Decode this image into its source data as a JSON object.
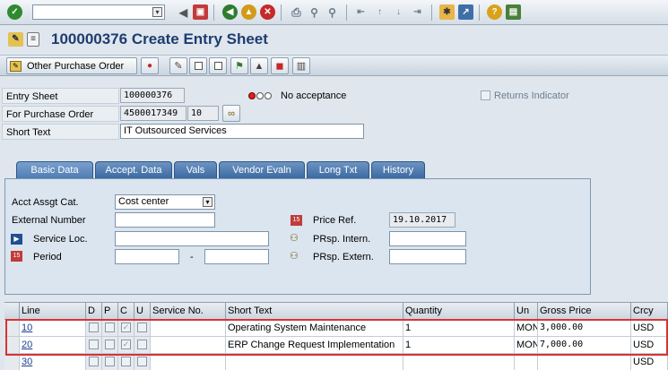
{
  "system_toolbar": {
    "command_field_value": "",
    "icons": [
      "enter-icon",
      "save-icon",
      "back-icon",
      "exit-icon",
      "cancel-icon",
      "print-icon",
      "find-icon",
      "find-next-icon",
      "first-page-icon",
      "previous-page-icon",
      "next-page-icon",
      "last-page-icon",
      "new-session-icon",
      "shortcut-icon",
      "help-icon",
      "customize-layout-icon"
    ]
  },
  "title": {
    "text": "100000376 Create Entry Sheet"
  },
  "app_toolbar": {
    "other_po_label": "Other Purchase Order"
  },
  "header": {
    "entry_sheet_label": "Entry Sheet",
    "entry_sheet_value": "100000376",
    "acceptance_text": "No acceptance",
    "returns_indicator_label": "Returns Indicator",
    "returns_indicator_checked": false,
    "po_label": "For Purchase Order",
    "po_value": "4500017349",
    "po_item": "10",
    "short_text_label": "Short Text",
    "short_text_value": "IT Outsourced Services"
  },
  "tabs": [
    {
      "label": "Basic Data",
      "active": true
    },
    {
      "label": "Accept. Data",
      "active": false
    },
    {
      "label": "Vals",
      "active": false
    },
    {
      "label": "Vendor Evaln",
      "active": false
    },
    {
      "label": "Long Txt",
      "active": false
    },
    {
      "label": "History",
      "active": false
    }
  ],
  "basic_data": {
    "acct_assgt_label": "Acct Assgt Cat.",
    "acct_assgt_value": "Cost center",
    "external_number_label": "External Number",
    "external_number_value": "",
    "service_loc_label": "Service Loc.",
    "service_loc_value": "",
    "period_label": "Period",
    "period_from": "",
    "period_sep": "-",
    "period_to": "",
    "price_ref_label": "Price Ref.",
    "price_ref_value": "19.10.2017",
    "prsp_intern_label": "PRsp. Intern.",
    "prsp_intern_value": "",
    "prsp_extern_label": "PRsp. Extern.",
    "prsp_extern_value": ""
  },
  "table": {
    "columns": [
      "Line",
      "D",
      "P",
      "C",
      "U",
      "Service No.",
      "Short Text",
      "Quantity",
      "Un",
      "Gross Price",
      "Crcy"
    ],
    "rows": [
      {
        "line": "10",
        "service_no": "",
        "short_text": "Operating System Maintenance",
        "quantity": "1",
        "unit": "MON",
        "gross_price": "3,000.00",
        "currency": "USD",
        "c_checked": true
      },
      {
        "line": "20",
        "service_no": "",
        "short_text": "ERP Change Request Implementation",
        "quantity": "1",
        "unit": "MON",
        "gross_price": "7,000.00",
        "currency": "USD",
        "c_checked": true
      },
      {
        "line": "30",
        "service_no": "",
        "short_text": "",
        "quantity": "",
        "unit": "",
        "gross_price": "",
        "currency": "USD",
        "c_checked": false
      }
    ]
  },
  "colors": {
    "title": "#1e3c70",
    "tab": "#3b6aa3",
    "highlight": "#d73434"
  }
}
